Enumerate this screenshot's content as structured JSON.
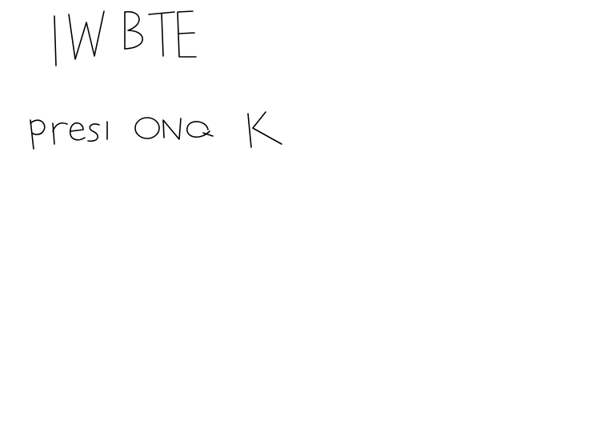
{
  "screen": {
    "title": "IWBTE",
    "instruction": "presiona K"
  },
  "colors": {
    "background": "#ffffff",
    "ink": "#000000"
  }
}
